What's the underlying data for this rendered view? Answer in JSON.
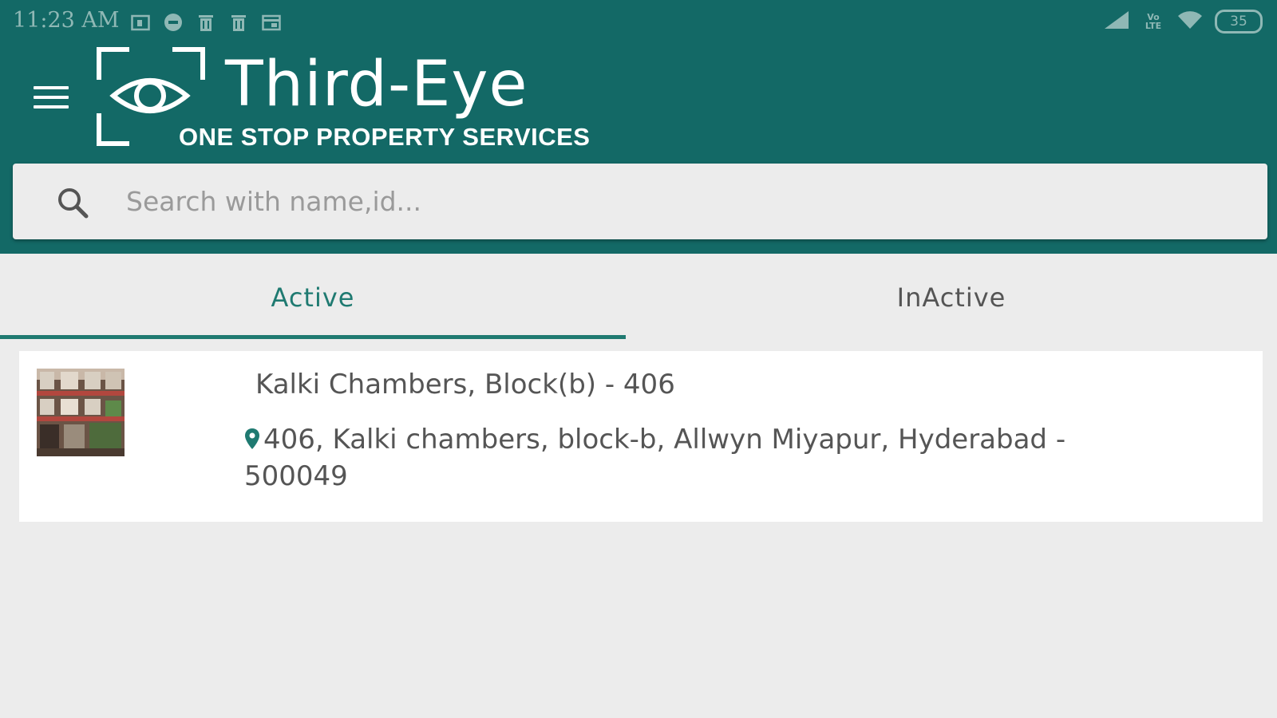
{
  "status_bar": {
    "time": "11:23 AM",
    "battery": "35",
    "network_label": "Vo LTE",
    "left_icons": [
      "calendar-icon",
      "whatsapp-icon",
      "trash-icon",
      "trash-icon",
      "card-icon"
    ],
    "right_icons": [
      "signal-icon",
      "volte-icon",
      "wifi-icon",
      "battery-icon"
    ]
  },
  "app_bar": {
    "logo_title": "Third-Eye",
    "logo_subtitle": "ONE STOP PROPERTY SERVICES",
    "menu_icon": "hamburger-menu-icon"
  },
  "search": {
    "placeholder": "Search with name,id...",
    "value": ""
  },
  "tabs": [
    {
      "label": "Active",
      "selected": true
    },
    {
      "label": "InActive",
      "selected": false
    }
  ],
  "properties": [
    {
      "name": "Kalki Chambers, Block(b) - 406",
      "address": "406, Kalki chambers, block-b, Allwyn Miyapur, Hyderabad - 500049"
    }
  ],
  "colors": {
    "primary": "#136966",
    "accent": "#1f7a71",
    "background": "#ececec",
    "card": "#ffffff"
  }
}
